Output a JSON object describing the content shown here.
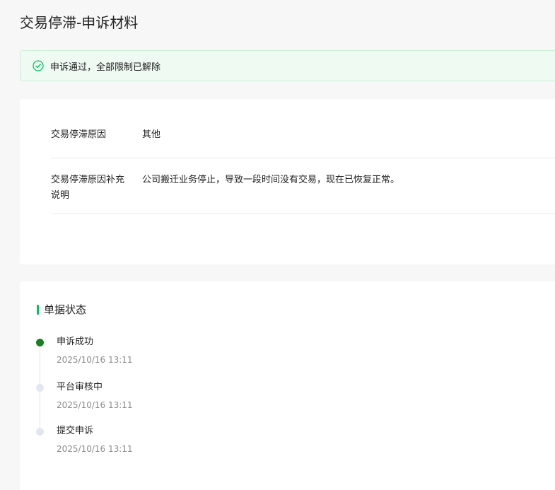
{
  "page": {
    "title": "交易停滞-申诉材料"
  },
  "notice": {
    "icon": "check-circle-icon",
    "text": "申诉通过，全部限制已解除",
    "color": "#07c160"
  },
  "info": {
    "rows": [
      {
        "label": "交易停滞原因",
        "value": "其他"
      },
      {
        "label": "交易停滞原因补充说明",
        "value": "公司搬迁业务停止，导致一段时间没有交易，现在已恢复正常。"
      }
    ]
  },
  "status": {
    "heading": "单据状态",
    "accent_color": "#07c160",
    "items": [
      {
        "title": "申诉成功",
        "time": "2025/10/16 13:11",
        "active": true
      },
      {
        "title": "平台审核中",
        "time": "2025/10/16 13:11",
        "active": false
      },
      {
        "title": "提交申诉",
        "time": "2025/10/16 13:11",
        "active": false
      }
    ]
  }
}
